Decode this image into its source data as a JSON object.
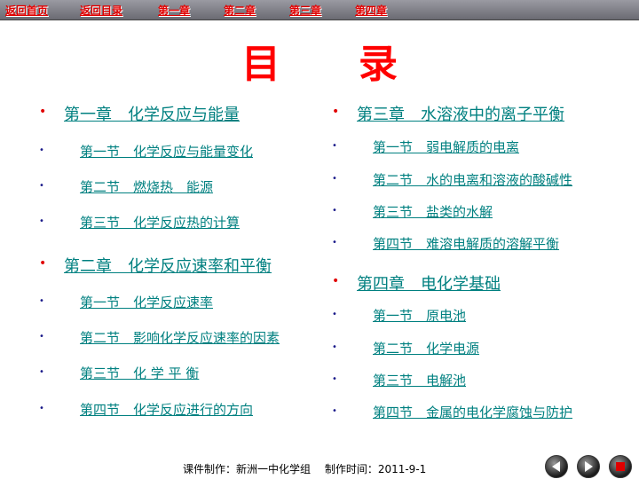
{
  "nav": {
    "items": [
      "返回首页",
      "返回目录",
      "第一章",
      "第二章",
      "第三章",
      "第四章"
    ]
  },
  "title": "目　　录",
  "left_column": {
    "chapter1": "第一章　化学反应与能量",
    "ch1_sections": [
      "第一节　化学反应与能量变化",
      "第二节　燃烧热　能源",
      "第三节　化学反应热的计算"
    ],
    "chapter2": "第二章　化学反应速率和平衡",
    "ch2_sections": [
      "第一节　化学反应速率",
      "第二节　影响化学反应速率的因素",
      "第三节　化 学 平 衡",
      "第四节　化学反应进行的方向"
    ]
  },
  "right_column": {
    "chapter3": "第三章　水溶液中的离子平衡",
    "ch3_sections": [
      "第一节　弱电解质的电离",
      "第二节　水的电离和溶液的酸碱性",
      "第三节　盐类的水解",
      "第四节　难溶电解质的溶解平衡"
    ],
    "chapter4": "第四章　电化学基础",
    "ch4_sections": [
      "第一节　原电池",
      "第二节　化学电源",
      "第三节　电解池",
      "第四节　金属的电化学腐蚀与防护"
    ]
  },
  "footer": "课件制作：新洲一中化学组　 制作时间：2011-9-1",
  "controls": {
    "icons": [
      "previous-icon",
      "next-icon",
      "stop-icon"
    ]
  },
  "colors": {
    "nav_text": "#e00000",
    "title": "#ff0000",
    "link": "#008080",
    "bullet_chapter": "#e00000",
    "bullet_section": "#1a1a8a"
  }
}
